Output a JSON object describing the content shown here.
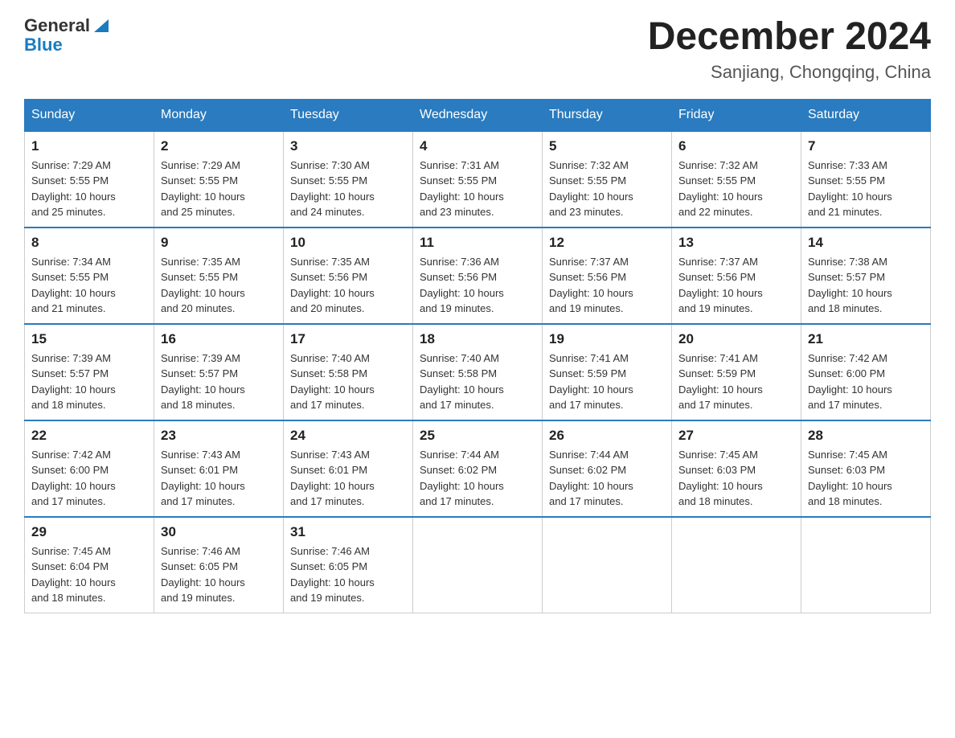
{
  "header": {
    "logo_general": "General",
    "logo_blue": "Blue",
    "title": "December 2024",
    "subtitle": "Sanjiang, Chongqing, China"
  },
  "days_of_week": [
    "Sunday",
    "Monday",
    "Tuesday",
    "Wednesday",
    "Thursday",
    "Friday",
    "Saturday"
  ],
  "weeks": [
    [
      {
        "day": "1",
        "sunrise": "7:29 AM",
        "sunset": "5:55 PM",
        "daylight": "10 hours and 25 minutes."
      },
      {
        "day": "2",
        "sunrise": "7:29 AM",
        "sunset": "5:55 PM",
        "daylight": "10 hours and 25 minutes."
      },
      {
        "day": "3",
        "sunrise": "7:30 AM",
        "sunset": "5:55 PM",
        "daylight": "10 hours and 24 minutes."
      },
      {
        "day": "4",
        "sunrise": "7:31 AM",
        "sunset": "5:55 PM",
        "daylight": "10 hours and 23 minutes."
      },
      {
        "day": "5",
        "sunrise": "7:32 AM",
        "sunset": "5:55 PM",
        "daylight": "10 hours and 23 minutes."
      },
      {
        "day": "6",
        "sunrise": "7:32 AM",
        "sunset": "5:55 PM",
        "daylight": "10 hours and 22 minutes."
      },
      {
        "day": "7",
        "sunrise": "7:33 AM",
        "sunset": "5:55 PM",
        "daylight": "10 hours and 21 minutes."
      }
    ],
    [
      {
        "day": "8",
        "sunrise": "7:34 AM",
        "sunset": "5:55 PM",
        "daylight": "10 hours and 21 minutes."
      },
      {
        "day": "9",
        "sunrise": "7:35 AM",
        "sunset": "5:55 PM",
        "daylight": "10 hours and 20 minutes."
      },
      {
        "day": "10",
        "sunrise": "7:35 AM",
        "sunset": "5:56 PM",
        "daylight": "10 hours and 20 minutes."
      },
      {
        "day": "11",
        "sunrise": "7:36 AM",
        "sunset": "5:56 PM",
        "daylight": "10 hours and 19 minutes."
      },
      {
        "day": "12",
        "sunrise": "7:37 AM",
        "sunset": "5:56 PM",
        "daylight": "10 hours and 19 minutes."
      },
      {
        "day": "13",
        "sunrise": "7:37 AM",
        "sunset": "5:56 PM",
        "daylight": "10 hours and 19 minutes."
      },
      {
        "day": "14",
        "sunrise": "7:38 AM",
        "sunset": "5:57 PM",
        "daylight": "10 hours and 18 minutes."
      }
    ],
    [
      {
        "day": "15",
        "sunrise": "7:39 AM",
        "sunset": "5:57 PM",
        "daylight": "10 hours and 18 minutes."
      },
      {
        "day": "16",
        "sunrise": "7:39 AM",
        "sunset": "5:57 PM",
        "daylight": "10 hours and 18 minutes."
      },
      {
        "day": "17",
        "sunrise": "7:40 AM",
        "sunset": "5:58 PM",
        "daylight": "10 hours and 17 minutes."
      },
      {
        "day": "18",
        "sunrise": "7:40 AM",
        "sunset": "5:58 PM",
        "daylight": "10 hours and 17 minutes."
      },
      {
        "day": "19",
        "sunrise": "7:41 AM",
        "sunset": "5:59 PM",
        "daylight": "10 hours and 17 minutes."
      },
      {
        "day": "20",
        "sunrise": "7:41 AM",
        "sunset": "5:59 PM",
        "daylight": "10 hours and 17 minutes."
      },
      {
        "day": "21",
        "sunrise": "7:42 AM",
        "sunset": "6:00 PM",
        "daylight": "10 hours and 17 minutes."
      }
    ],
    [
      {
        "day": "22",
        "sunrise": "7:42 AM",
        "sunset": "6:00 PM",
        "daylight": "10 hours and 17 minutes."
      },
      {
        "day": "23",
        "sunrise": "7:43 AM",
        "sunset": "6:01 PM",
        "daylight": "10 hours and 17 minutes."
      },
      {
        "day": "24",
        "sunrise": "7:43 AM",
        "sunset": "6:01 PM",
        "daylight": "10 hours and 17 minutes."
      },
      {
        "day": "25",
        "sunrise": "7:44 AM",
        "sunset": "6:02 PM",
        "daylight": "10 hours and 17 minutes."
      },
      {
        "day": "26",
        "sunrise": "7:44 AM",
        "sunset": "6:02 PM",
        "daylight": "10 hours and 17 minutes."
      },
      {
        "day": "27",
        "sunrise": "7:45 AM",
        "sunset": "6:03 PM",
        "daylight": "10 hours and 18 minutes."
      },
      {
        "day": "28",
        "sunrise": "7:45 AM",
        "sunset": "6:03 PM",
        "daylight": "10 hours and 18 minutes."
      }
    ],
    [
      {
        "day": "29",
        "sunrise": "7:45 AM",
        "sunset": "6:04 PM",
        "daylight": "10 hours and 18 minutes."
      },
      {
        "day": "30",
        "sunrise": "7:46 AM",
        "sunset": "6:05 PM",
        "daylight": "10 hours and 19 minutes."
      },
      {
        "day": "31",
        "sunrise": "7:46 AM",
        "sunset": "6:05 PM",
        "daylight": "10 hours and 19 minutes."
      },
      null,
      null,
      null,
      null
    ]
  ],
  "labels": {
    "sunrise": "Sunrise:",
    "sunset": "Sunset:",
    "daylight": "Daylight:"
  }
}
